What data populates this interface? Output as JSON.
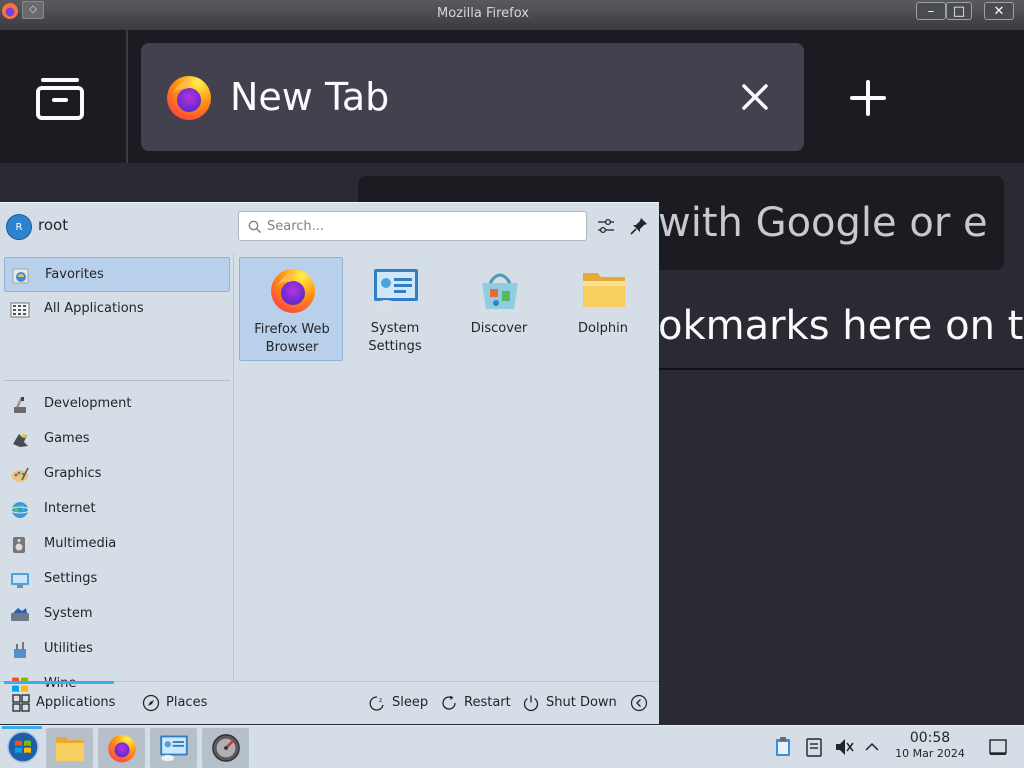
{
  "window": {
    "title": "Mozilla Firefox",
    "buttons": {
      "keep_above": "◇",
      "minimize": "–",
      "maximize": "□",
      "close": "✕"
    }
  },
  "firefox": {
    "tab": {
      "title": "New Tab"
    },
    "search_prompt": "with Google or e",
    "bookmarks_hint": "okmarks here on t"
  },
  "launcher": {
    "user": {
      "initial": "R",
      "name": "root"
    },
    "search": {
      "placeholder": "Search..."
    },
    "categories": [
      {
        "label": "Favorites",
        "icon": "favorites-icon",
        "selected": true
      },
      {
        "label": "All Applications",
        "icon": "all-applications-icon"
      },
      {
        "label": "Development",
        "icon": "development-icon"
      },
      {
        "label": "Games",
        "icon": "games-icon"
      },
      {
        "label": "Graphics",
        "icon": "graphics-icon"
      },
      {
        "label": "Internet",
        "icon": "internet-icon"
      },
      {
        "label": "Multimedia",
        "icon": "multimedia-icon"
      },
      {
        "label": "Settings",
        "icon": "settings-icon"
      },
      {
        "label": "System",
        "icon": "system-icon"
      },
      {
        "label": "Utilities",
        "icon": "utilities-icon"
      },
      {
        "label": "Wine",
        "icon": "wine-icon"
      }
    ],
    "favorites": [
      {
        "label": "Firefox Web Browser",
        "icon": "firefox-icon",
        "selected": true
      },
      {
        "label": "System Settings",
        "icon": "system-settings-icon"
      },
      {
        "label": "Discover",
        "icon": "discover-icon"
      },
      {
        "label": "Dolphin",
        "icon": "dolphin-folder-icon"
      }
    ],
    "footer": {
      "applications": "Applications",
      "places": "Places",
      "sleep": "Sleep",
      "restart": "Restart",
      "shutdown": "Shut Down"
    }
  },
  "taskbar": {
    "clock": {
      "time": "00:58",
      "date": "10 Mar 2024"
    },
    "tasks": [
      "dolphin-icon",
      "firefox-icon",
      "system-settings-icon",
      "disk-utility-icon"
    ],
    "tray": [
      "clipboard-icon",
      "storage-icon",
      "volume-muted-icon",
      "expand-tray-icon",
      "show-desktop-icon"
    ]
  },
  "colors": {
    "accent": "#3daee9",
    "launcher_bg": "#d5dde6",
    "selection": "#b8d0ea",
    "firefox_bg": "#1c1b22",
    "firefox_tab": "#42414d"
  }
}
